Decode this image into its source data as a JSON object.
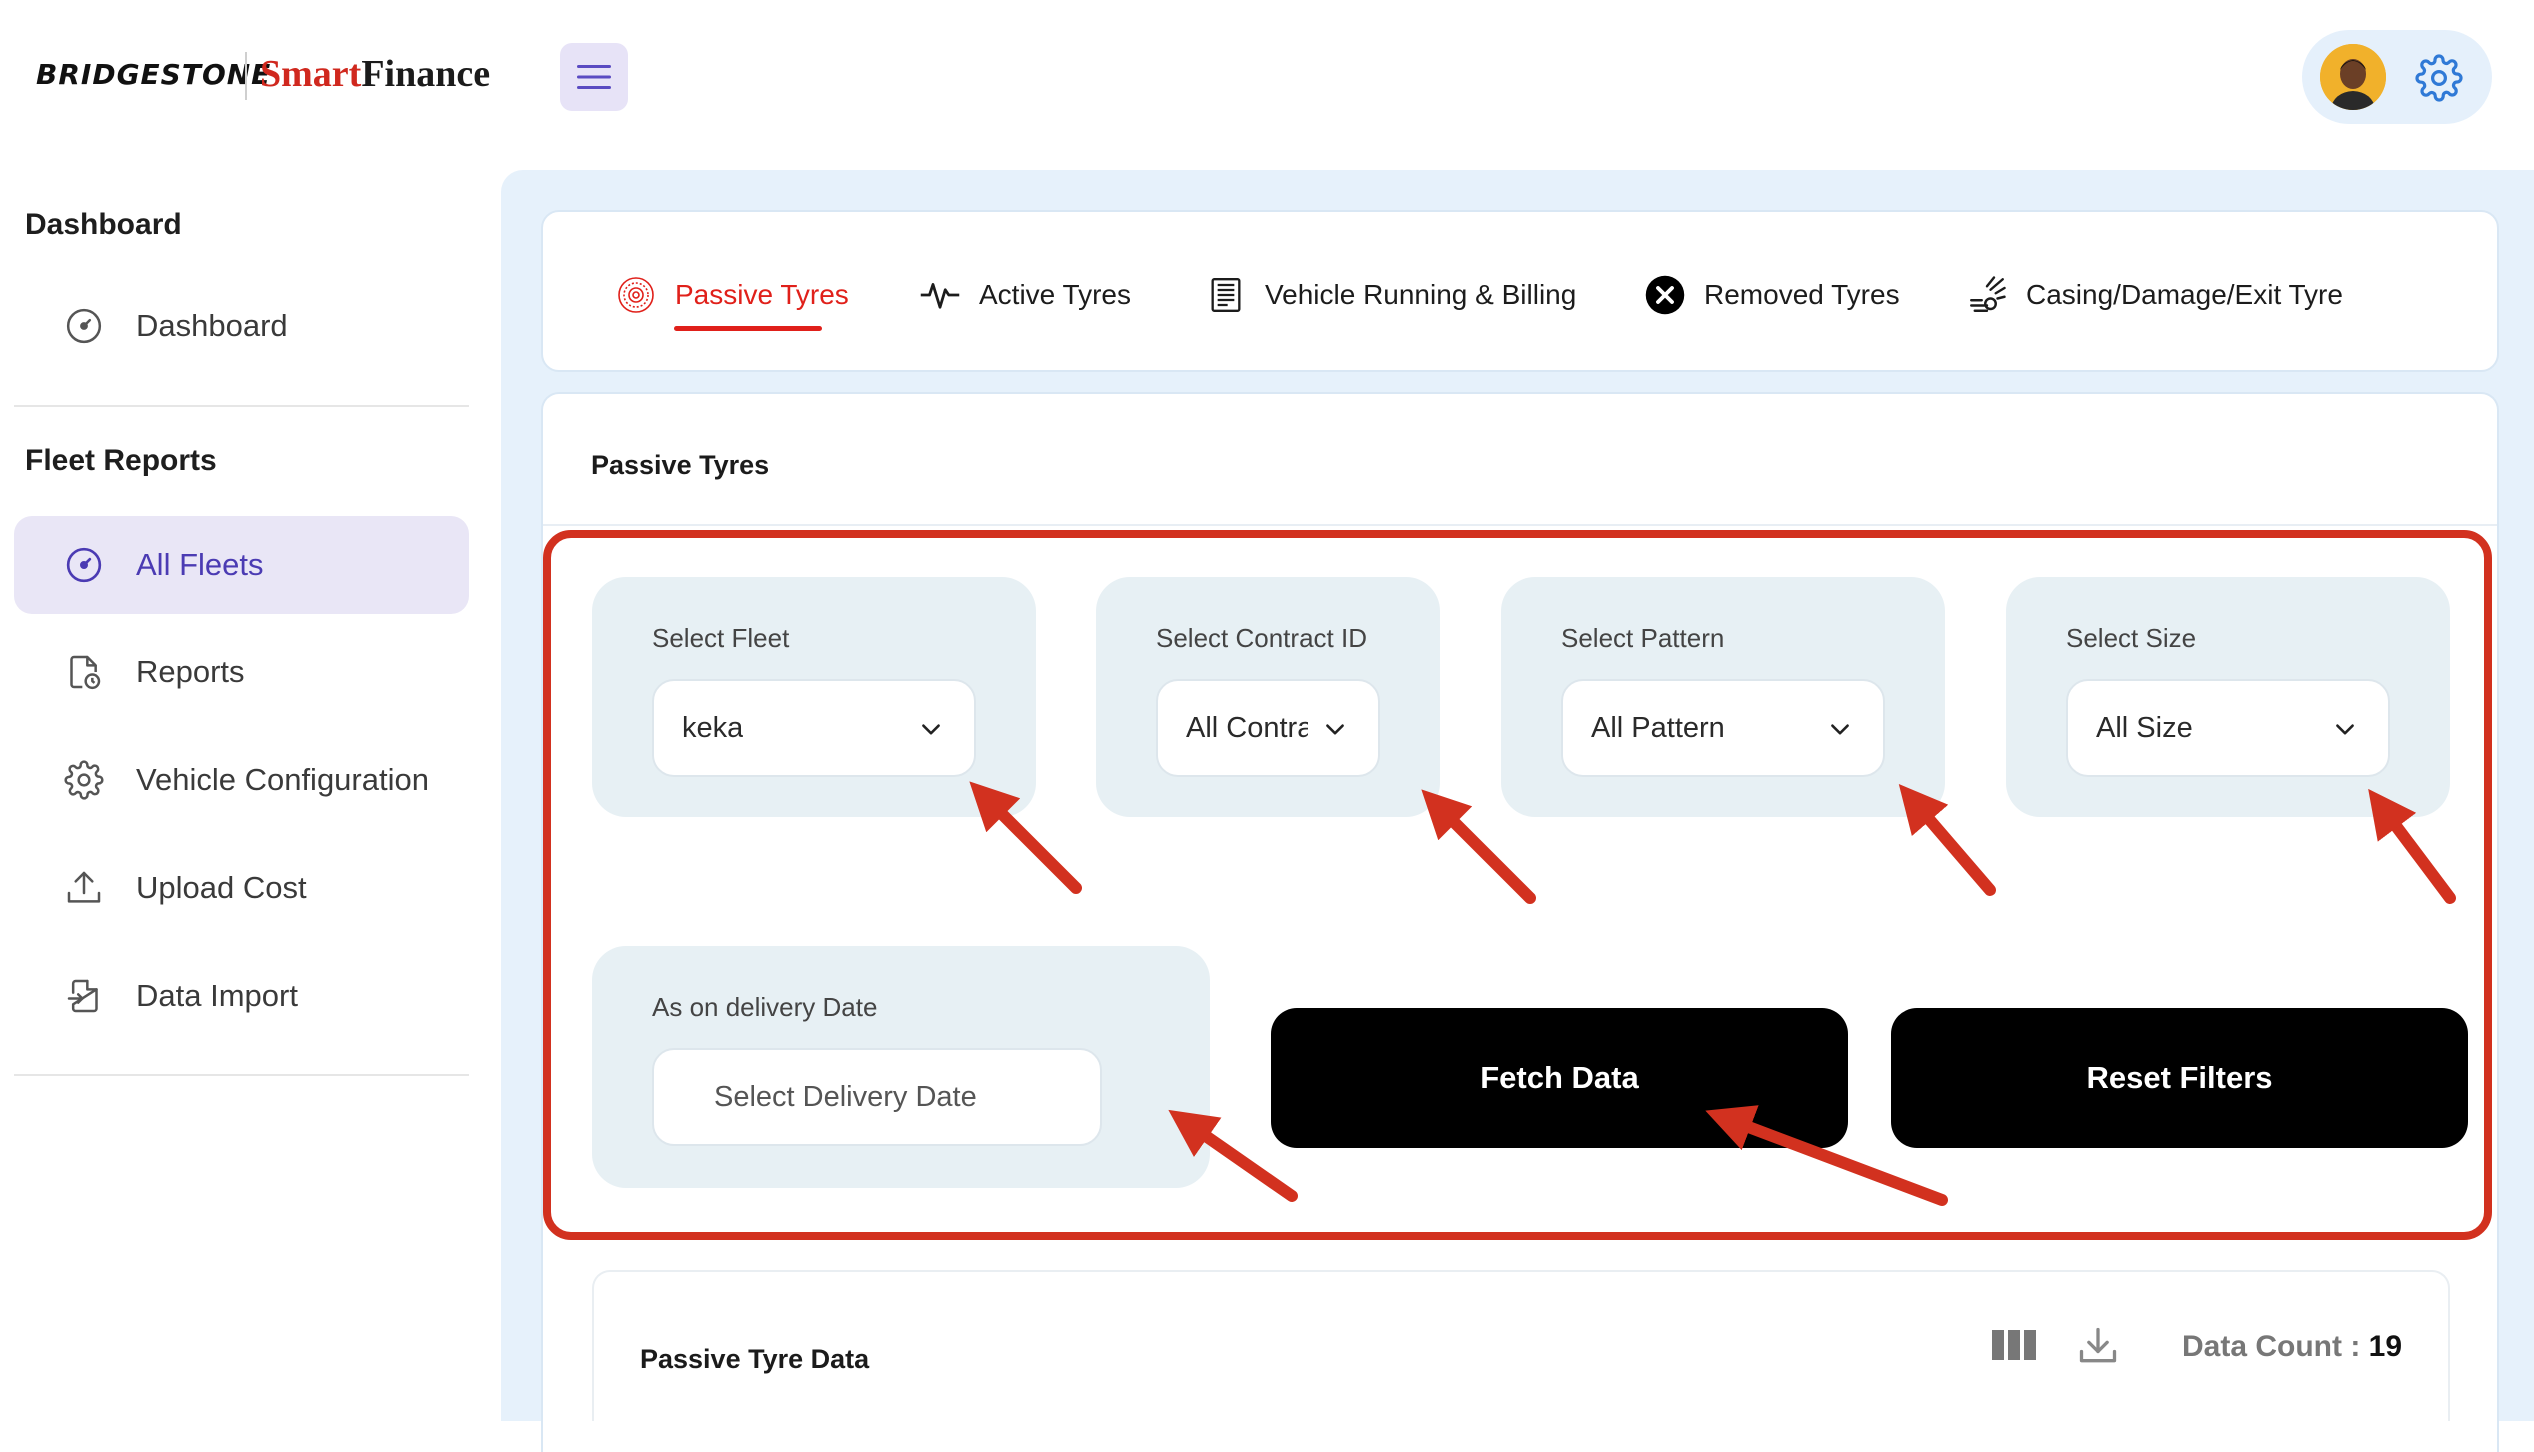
{
  "header": {
    "brand_left": "BRIDGESTONE",
    "brand_right_red": "Smart",
    "brand_right_black": "Finance",
    "menu_icon": "hamburger-menu-icon",
    "settings_icon": "gear-icon"
  },
  "sidebar": {
    "section1_title": "Dashboard",
    "section1_items": [
      {
        "label": "Dashboard",
        "icon": "gauge-icon"
      }
    ],
    "section2_title": "Fleet Reports",
    "section2_items": [
      {
        "label": "All Fleets",
        "icon": "gauge-icon",
        "active": true
      },
      {
        "label": "Reports",
        "icon": "report-clock-icon"
      },
      {
        "label": "Vehicle Configuration",
        "icon": "gear-icon"
      },
      {
        "label": "Upload Cost",
        "icon": "upload-icon"
      },
      {
        "label": "Data Import",
        "icon": "file-import-icon"
      }
    ]
  },
  "tabs": [
    {
      "label": "Passive Tyres",
      "icon": "tyre-icon",
      "active": true
    },
    {
      "label": "Active Tyres",
      "icon": "pulse-icon"
    },
    {
      "label": "Vehicle Running & Billing",
      "icon": "invoice-icon"
    },
    {
      "label": "Removed Tyres",
      "icon": "close-circle-icon"
    },
    {
      "label": "Casing/Damage/Exit Tyre",
      "icon": "damage-icon"
    }
  ],
  "content": {
    "section_title": "Passive Tyres",
    "filters": {
      "fleet": {
        "label": "Select Fleet",
        "value": "keka"
      },
      "contract": {
        "label": "Select Contract ID",
        "value": "All Contra"
      },
      "pattern": {
        "label": "Select Pattern",
        "value": "All Pattern"
      },
      "size": {
        "label": "Select Size",
        "value": "All Size"
      },
      "delivery_date": {
        "label": "As on delivery Date",
        "placeholder": "Select Delivery Date"
      }
    },
    "buttons": {
      "fetch": "Fetch Data",
      "reset": "Reset Filters"
    }
  },
  "data_panel": {
    "title": "Passive Tyre Data",
    "count_label": "Data Count :",
    "count_value": "19",
    "columns_icon": "columns-icon",
    "download_icon": "download-icon"
  },
  "colors": {
    "accent_red": "#d0281e",
    "highlight_red": "#d2311f",
    "active_purple": "#4b3bb3",
    "main_bg": "#e6f1fb"
  }
}
